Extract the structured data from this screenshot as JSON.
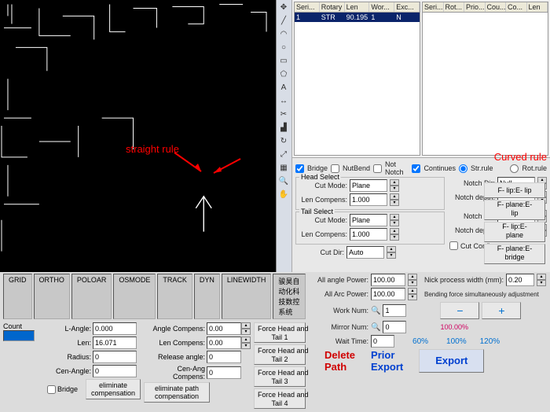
{
  "tables": {
    "left_headers": [
      "Seri...",
      "Rotary an...",
      "Len",
      "Wor...",
      "Exc..."
    ],
    "left_row": [
      "1",
      "STR",
      "90.195",
      "1",
      "N"
    ],
    "right_headers": [
      "Seri...",
      "Rot...",
      "Prio...",
      "Cou...",
      "Co...",
      "Len"
    ]
  },
  "annotations": {
    "straight": "straight rule",
    "curved": "Curved rule"
  },
  "checks": {
    "bridge": "Bridge",
    "nutbend": "NutBend",
    "notnotch": "Not Notch",
    "continues": "Continues",
    "strrule": "Str.rule",
    "rotrule": "Rot.rule"
  },
  "status": {
    "grid": "GRID",
    "ortho": "ORTHO",
    "poloar": "POLOAR",
    "osmode": "OSMODE",
    "track": "TRACK",
    "dyn": "DYN",
    "linewidth": "LINEWIDTH",
    "title": "骏昊自动化科技数控系统"
  },
  "leftpanel": {
    "count": "Count",
    "langle_l": "L-Angle:",
    "langle": "0.000",
    "len_l": "Len:",
    "len": "16.071",
    "radius_l": "Radius:",
    "radius": "0",
    "cenangle_l": "Cen-Angle:",
    "cenangle": "0",
    "anglecomp_l": "Angle Compens:",
    "anglecomp": "0.00",
    "lencomp_l": "Len Compens:",
    "lencomp": "0.00",
    "release_l": "Release angle:",
    "release": "0",
    "cenangc_l": "Cen-Ang Compens:",
    "cenangc": "0",
    "bridge_l": "Bridge",
    "elimcomp": "eliminate compensation",
    "elimpath": "eliminate path compensation",
    "fht1": "Force Head and\nTail 1",
    "fht2": "Force Head and\nTail 2",
    "fht3": "Force Head and\nTail 3",
    "fht4": "Force Head and\nTail 4"
  },
  "params": {
    "headsel": "Head Select",
    "tailsel": "Tail Select",
    "cutmode_l": "Cut Mode:",
    "cutmode": "Plane",
    "lencomp_l": "Len Compens:",
    "lencomp": "1.000",
    "cutdir_l": "Cut Dir:",
    "cutdir": "Auto",
    "notchdir_l": "Notch Dir:",
    "notchdir": "Null",
    "notchdepth_l": "Notch depth:",
    "notchdepth": "",
    "cutconfirm": "Cut Confirm",
    "allangle_l": "All angle Power:",
    "allangle": "100.00",
    "allarc_l": "All Arc Power:",
    "allarc": "100.00",
    "worknum_l": "Work Num:",
    "worknum": "1",
    "mirrornum_l": "Mirror Num:",
    "mirrornum": "0",
    "waittime_l": "Wait Time:",
    "waittime": "0",
    "nick_l": "Nick process width (mm):",
    "nick": "0.20",
    "bendforce": "Bending force simultaneously adjustment",
    "p100": "100.00%",
    "p60": "60%",
    "p100b": "100%",
    "p120": "120%",
    "flipe": "F- lip:E- lip",
    "fplanee": "F- plane:E-\nlip",
    "flipep": "F- lip:E-\nplane",
    "fplaneeb": "F- plane:E-\nbridge"
  },
  "actions": {
    "delete": "Delete\nPath",
    "prior": "Prior\nExport",
    "export": "Export"
  }
}
